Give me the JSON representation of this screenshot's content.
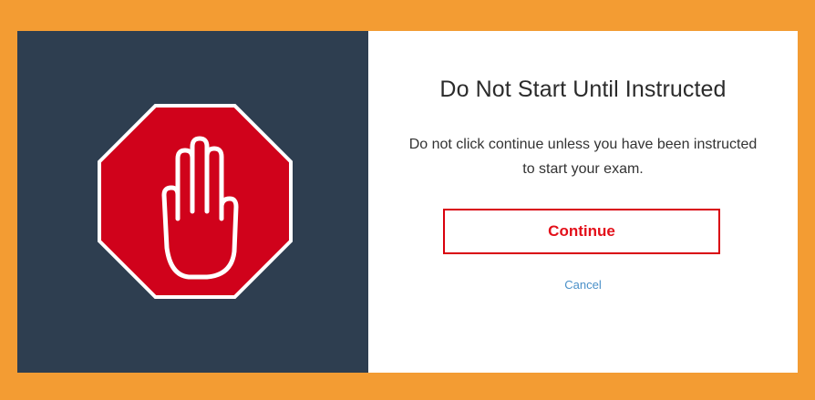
{
  "dialog": {
    "title": "Do Not Start Until Instructed",
    "message": "Do not click continue unless you have been instructed to start your exam.",
    "continue_label": "Continue",
    "cancel_label": "Cancel"
  },
  "icons": {
    "stop": "stop-hand-icon"
  },
  "colors": {
    "page_border": "#f39c33",
    "left_panel": "#2e3e50",
    "stop_sign_red": "#d0021b",
    "continue_border": "#d9000d",
    "continue_text": "#e3101a",
    "cancel_link": "#4a90c8"
  }
}
